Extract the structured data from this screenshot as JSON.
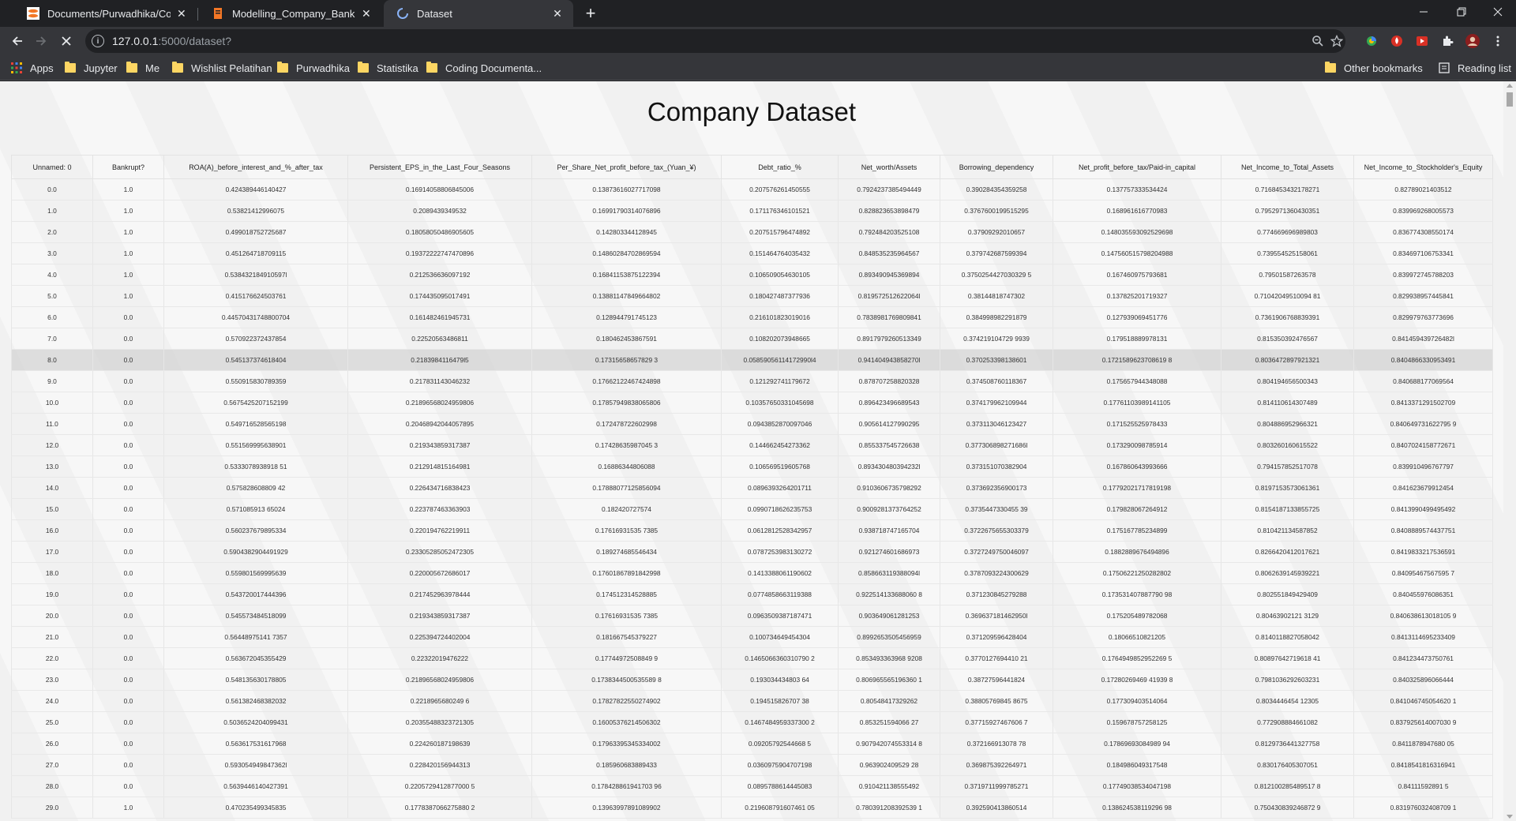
{
  "browser": {
    "tabs": [
      {
        "title": "Documents/Purwadhika/Compan",
        "icon": "jupyter-icon",
        "active": false
      },
      {
        "title": "Modelling_Company_Bankruptcy",
        "icon": "notebook-icon",
        "active": false
      },
      {
        "title": "Dataset",
        "icon": "loading-spinner-icon",
        "active": true
      }
    ],
    "address": {
      "host": "127.0.0.1",
      "path": ":5000/dataset?"
    },
    "bookmarks": [
      "Apps",
      "Jupyter",
      "Me",
      "Wishlist Pelatihan",
      "Purwadhika",
      "Statistika",
      "Coding Documenta..."
    ],
    "other_bookmarks": "Other bookmarks",
    "reading_list": "Reading list"
  },
  "page": {
    "title": "Company Dataset",
    "columns": [
      "Unnamed: 0",
      "Bankrupt?",
      "ROA(A)_before_interest_and_%_after_tax",
      "Persistent_EPS_in_the_Last_Four_Seasons",
      "Per_Share_Net_profit_before_tax_(Yuan_¥)",
      "Debt_ratio_%",
      "Net_worth/Assets",
      "Borrowing_dependency",
      "Net_profit_before_tax/Paid-in_capital",
      "Net_Income_to_Total_Assets",
      "Net_Income_to_Stockholder's_Equity"
    ],
    "rows": [
      [
        "0.0",
        "1.0",
        "0.424389446140427",
        "0.16914058806845006",
        "0.13873616027717098",
        "0.207576261450555",
        "0.7924237385494449",
        "0.390284354359258",
        "0.137757333534424",
        "0.7168453432178271",
        "0.82789021403512"
      ],
      [
        "1.0",
        "1.0",
        "0.53821412996075",
        "0.2089439349532",
        "0.16991790314076896",
        "0.171176346101521",
        "0.828823653898479",
        "0.3767600199515295",
        "0.168961616770983",
        "0.7952971360430351",
        "0.839969268005573"
      ],
      [
        "2.0",
        "1.0",
        "0.499018752725687",
        "0.18058050486905605",
        "0.142803344128945",
        "0.207515796474892",
        "0.792484203525108",
        "0.37909292010657",
        "0.148035593092529698",
        "0.774669696989803",
        "0.836774308550174"
      ],
      [
        "3.0",
        "1.0",
        "0.451264718709115",
        "0.19372222747470896",
        "0.14860284702869594",
        "0.151464764035432",
        "0.848535235964567",
        "0.379742687599394",
        "0.147560515798204988",
        "0.739554525158061",
        "0.834697106753341"
      ],
      [
        "4.0",
        "1.0",
        "0.538432184910597l",
        "0.212536636097192",
        "0.16841153875122394",
        "0.106509054630105",
        "0.893490945369894",
        "0.3750254427030329 5",
        "0.167460975793681",
        "0.79501587263578",
        "0.839972745788203"
      ],
      [
        "5.0",
        "1.0",
        "0.415176624503761",
        "0.174435095017491",
        "0.13881147849664802",
        "0.180427487377936",
        "0.819572512622064l",
        "0.38144818747302",
        "0.137825201719327",
        "0.71042049510094 81",
        "0.829938957445841"
      ],
      [
        "6.0",
        "0.0",
        "0.44570431748800704",
        "0.161482461945731",
        "0.128944791745123",
        "0.216101823019016",
        "0.7838981769809841",
        "0.384998982291879",
        "0.127939069451776",
        "0.7361906768839391",
        "0.829979763773696"
      ],
      [
        "7.0",
        "0.0",
        "0.570922372437854",
        "0.22520563486811",
        "0.180462453867591",
        "0.108202073948665",
        "0.8917979260513349",
        "0.374219104729 9939",
        "0.179518889978131",
        "0.815350392476567",
        "0.841459439726482l"
      ],
      [
        "8.0",
        "0.0",
        "0.545137374618404",
        "0.2183984116479l5",
        "0.17315658657829 3",
        "0.05859056114172990l4",
        "0.941404943858270l",
        "0.370253398138601",
        "0.1721589623708619 8",
        "0.8036472897921321",
        "0.8404866330953491"
      ],
      [
        "9.0",
        "0.0",
        "0.550915830789359",
        "0.217831143046232",
        "0.17662122467424898",
        "0.121292741179672",
        "0.878707258820328",
        "0.374508760118367",
        "0.175657944348088",
        "0.804194656500343",
        "0.840688177069564"
      ],
      [
        "10.0",
        "0.0",
        "0.5675425207152199",
        "0.21896568024959806",
        "0.17857949838065806",
        "0.10357650331045698",
        "0.896423496689543",
        "0.374179962109944",
        "0.17761103989141105",
        "0.814110614307489",
        "0.8413371291502709"
      ],
      [
        "11.0",
        "0.0",
        "0.549716528565198",
        "0.20468942044057895",
        "0.172478722602998",
        "0.0943852870097046",
        "0.905614127990295",
        "0.373113046123427",
        "0.171525525978433",
        "0.804886952966321",
        "0.840649731622795 9"
      ],
      [
        "12.0",
        "0.0",
        "0.551569995638901",
        "0.219343859317387",
        "0.17428635987045 3",
        "0.144662454273362",
        "0.855337545726638",
        "0.377306898271686l",
        "0.173290098785914",
        "0.803260160615522",
        "0.8407024158772671"
      ],
      [
        "13.0",
        "0.0",
        "0.5333078938918 51",
        "0.212914815164981",
        "0.16886344806088",
        "0.106569519605768",
        "0.893430480394232l",
        "0.373151070382904",
        "0.167860643993666",
        "0.794157852517078",
        "0.839910496767797"
      ],
      [
        "14.0",
        "0.0",
        "0.575828608809 42",
        "0.226434716838423",
        "0.17888077125856094",
        "0.0896393264201711",
        "0.9103606735798292",
        "0.373692356900173",
        "0.17792021717819198",
        "0.8197153573061361",
        "0.841623679912454"
      ],
      [
        "15.0",
        "0.0",
        "0.571085913 65024",
        "0.223787463363903",
        "0.182420727574",
        "0.0990718626235753",
        "0.9009281373764252",
        "0.3735447330455 39",
        "0.179828067264912",
        "0.8154187133855725",
        "0.8413990499495492"
      ],
      [
        "16.0",
        "0.0",
        "0.560237679895334",
        "0.220194762219911",
        "0.17616931535 7385",
        "0.0612812528342957",
        "0.938718747165704",
        "0.3722675655303379",
        "0.175167785234899",
        "0.810421134587852",
        "0.8408889574437751"
      ],
      [
        "17.0",
        "0.0",
        "0.5904382904491929",
        "0.23305285052472305",
        "0.189274685546434",
        "0.0787253983130272",
        "0.921274601686973",
        "0.3727249750046097",
        "0.1882889676494896",
        "0.8266420412017621",
        "0.8419833217536591"
      ],
      [
        "18.0",
        "0.0",
        "0.559801569995639",
        "0.220005672686017",
        "0.17601867891842998",
        "0.1413388061190602",
        "0.858663119388094l",
        "0.3787093224300629",
        "0.17506221250282802",
        "0.8062639145939221",
        "0.84095467567595 7"
      ],
      [
        "19.0",
        "0.0",
        "0.543720017444396",
        "0.217452963978444",
        "0.174512314528885",
        "0.0774858663119388",
        "0.922514133688060 8",
        "0.371230845279288",
        "0.173531407887790 98",
        "0.802551849429409",
        "0.840455976086351"
      ],
      [
        "20.0",
        "0.0",
        "0.545573484518099",
        "0.219343859317387",
        "0.17616931535 7385",
        "0.0963509387187471",
        "0.903649061281253",
        "0.369637181462950l",
        "0.175205489782068",
        "0.80463902121 3129",
        "0.840638613018105 9"
      ],
      [
        "21.0",
        "0.0",
        "0.56448975141 7357",
        "0.225394724402004",
        "0.181667545379227",
        "0.100734649454304",
        "0.8992653505456959",
        "0.371209596428404",
        "0.18066510821205",
        "0.8140118827058042",
        "0.8413114695233409"
      ],
      [
        "22.0",
        "0.0",
        "0.563672045355429",
        "0.22322019476222",
        "0.17744972508849 9",
        "0.1465066360310790 2",
        "0.853493363968 9208",
        "0.3770127694410 21",
        "0.1764949852952269 5",
        "0.80897642719618 41",
        "0.841234473750761"
      ],
      [
        "23.0",
        "0.0",
        "0.548135630178805",
        "0.21896568024959806",
        "0.1738344500535589 8",
        "0.193034434803 64",
        "0.806965565196360 1",
        "0.38727596441824",
        "0.17280269469 41939 8",
        "0.7981036292603231",
        "0.840325896066444"
      ],
      [
        "24.0",
        "0.0",
        "0.561382468382032",
        "0.2218965680249 6",
        "0.17827822550274902",
        "0.194515826707 38",
        "0.80548417329262",
        "0.38805769845 8675",
        "0.177309403514064",
        "0.8034446454 12305",
        "0.841046745054620 1"
      ],
      [
        "25.0",
        "0.0",
        "0.5036524204099431",
        "0.20355488323721305",
        "0.16005376214506302",
        "0.1467484959337300 2",
        "0.853251594066 27",
        "0.37715927467606 7",
        "0.159678757258125",
        "0.772908884661082",
        "0.837925614007030 9"
      ],
      [
        "26.0",
        "0.0",
        "0.563617531617968",
        "0.224260187198639",
        "0.17963395345334002",
        "0.09205792544668 5",
        "0.907942074553314 8",
        "0.372166913078 78",
        "0.17869693084989 94",
        "0.8129736441327758",
        "0.8411878947680 05"
      ],
      [
        "27.0",
        "0.0",
        "0.593054949847362l",
        "0.228420156944313",
        "0.185960683889433",
        "0.0360975904707198",
        "0.963902409529 28",
        "0.369875392264971",
        "0.184986049317548",
        "0.830176405307051",
        "0.8418541816316941"
      ],
      [
        "28.0",
        "0.0",
        "0.5639446140427391",
        "0.2205729412877000 5",
        "0.178428861941703 96",
        "0.0895788614445083",
        "0.910421138555492",
        "0.3719711999785271",
        "0.17749038534047198",
        "0.812100285489517 8",
        "0.84111592891 5"
      ],
      [
        "29.0",
        "1.0",
        "0.470235499345835",
        "0.1778387066275880 2",
        "0.13963997891089902",
        "0.219608791607461 05",
        "0.780391208392539 1",
        "0.392590413860514",
        "0.138624538119296 98",
        "0.750430839246872 9",
        "0.831976032408709 1"
      ]
    ],
    "highlighted_row": 8
  }
}
